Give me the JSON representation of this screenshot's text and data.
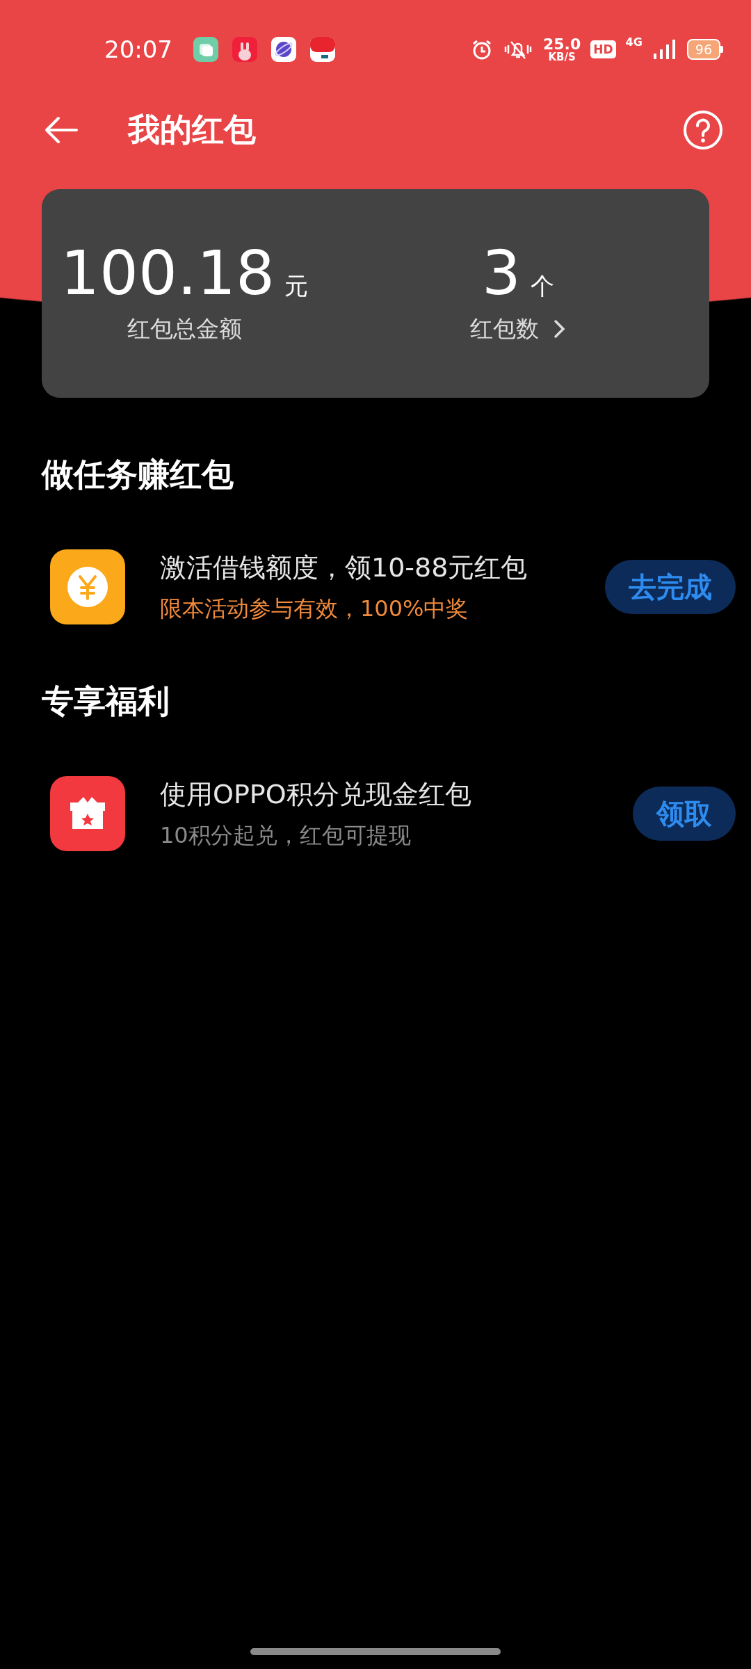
{
  "status_bar": {
    "time": "20:07",
    "speed_value": "25.0",
    "speed_unit": "KB/S",
    "hd": "HD",
    "network": "4G",
    "battery": "96"
  },
  "app_bar": {
    "title": "我的红包"
  },
  "summary": {
    "amount": "100.18",
    "amount_unit": "元",
    "amount_label": "红包总金额",
    "count": "3",
    "count_unit": "个",
    "count_label": "红包数"
  },
  "sections": [
    {
      "title": "做任务赚红包",
      "items": [
        {
          "kind": "coin",
          "title": "激活借钱额度，领10-88元红包",
          "subtitle": "限本活动参与有效，100%中奖",
          "highlight": true,
          "button": "去完成"
        }
      ]
    },
    {
      "title": "专享福利",
      "items": [
        {
          "kind": "gift",
          "title": "使用OPPO积分兑现金红包",
          "subtitle": "10积分起兑，红包可提现",
          "highlight": false,
          "button": "领取"
        }
      ]
    }
  ]
}
